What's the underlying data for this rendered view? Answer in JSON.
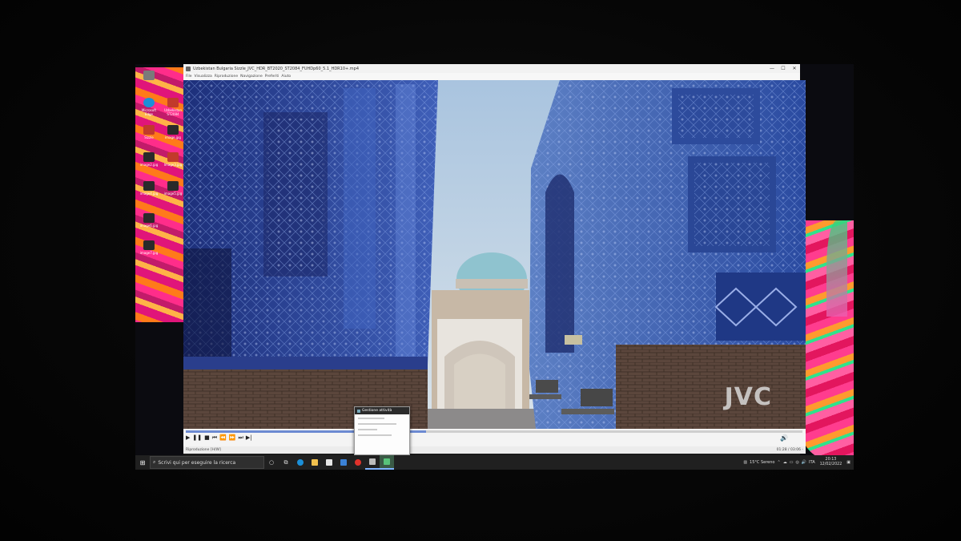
{
  "window": {
    "title": "Uzbekistan Bulgaria Sizzle_JVC_HDR_BT2020_ST2084_FUHDp60_5.1_HDR10+.mp4",
    "minimize": "—",
    "maximize": "☐",
    "close": "✕"
  },
  "menu": [
    "File",
    "Visualizza",
    "Riproduzione",
    "Navigazione",
    "Preferiti",
    "Aiuto"
  ],
  "video": {
    "watermark": "JVC"
  },
  "playback": {
    "progress": 0.39,
    "buttons": [
      "▶",
      "❚❚",
      "■",
      "⏮",
      "⏪",
      "⏩",
      "⏭",
      "▶|"
    ],
    "volume_icon": "🔊"
  },
  "status": {
    "state": "Riproduzione [H/W]",
    "time": "01:28 / 03:06 -"
  },
  "popup": {
    "title": "Gestione attività"
  },
  "desktop": {
    "icons": [
      {
        "label": "",
        "color": "#7a7a7a"
      },
      {
        "label": "Microsoft Edge",
        "color": "#1b8fd8"
      },
      {
        "label": "Uzbekistan ST2084",
        "color": "#c23a2b"
      },
      {
        "label": "Sizzle",
        "color": "#c23a2b"
      },
      {
        "label": "image.jpg",
        "color": "#2a2a2a"
      },
      {
        "label": "image2.jpg",
        "color": "#2a2a2a"
      },
      {
        "label": "Image3.jpg",
        "color": "#c23a2b"
      },
      {
        "label": "image4.jpg",
        "color": "#2a2a2a"
      },
      {
        "label": "image5.jpg",
        "color": "#2a2a2a"
      },
      {
        "label": "image6.jpg",
        "color": "#2a2a2a"
      },
      {
        "label": "image7.jpg",
        "color": "#2a2a2a"
      }
    ]
  },
  "taskbar": {
    "start_icon": "⊞",
    "search_placeholder": "Scrivi qui per eseguire la ricerca",
    "apps": [
      {
        "name": "cortana",
        "glyph": "○",
        "color": ""
      },
      {
        "name": "task-view",
        "glyph": "⧉",
        "color": ""
      },
      {
        "name": "edge",
        "glyph": "",
        "color": "#1b8fd8"
      },
      {
        "name": "explorer",
        "glyph": "",
        "color": "#f2c14e"
      },
      {
        "name": "store",
        "glyph": "",
        "color": "#e6e6e6"
      },
      {
        "name": "mail",
        "glyph": "",
        "color": "#3b82d6"
      },
      {
        "name": "opera",
        "glyph": "",
        "color": "#e0322b"
      },
      {
        "name": "app-gray",
        "glyph": "",
        "color": "#bcbcbc"
      },
      {
        "name": "task-manager",
        "glyph": "",
        "color": "#58c37a"
      }
    ],
    "weather": "15°C Sereno",
    "tray_icons": [
      "⌃",
      "☁",
      "▭",
      "◎",
      "🔊",
      "ITA"
    ],
    "time": "20:13",
    "date": "12/02/2022",
    "notification_icon": "▣"
  },
  "colors": {
    "taskbar_bg": "#202020",
    "seek_fill": "#6c8ad2",
    "sky": "#b8cde0",
    "tile_blue": "#2c4fa6"
  }
}
